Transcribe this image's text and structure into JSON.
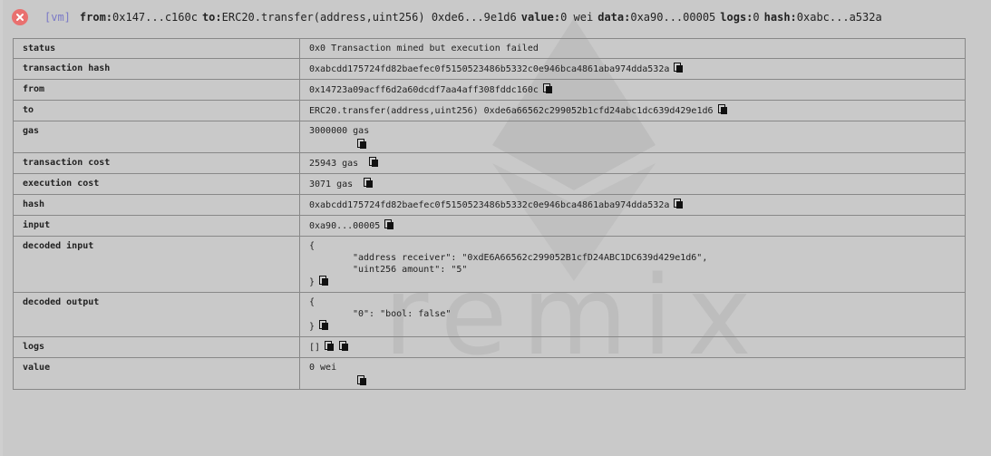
{
  "summary": {
    "env": "[vm]",
    "from_key": "from:",
    "from_value": "0x147...c160c",
    "to_key": "to:",
    "to_value": "ERC20.transfer(address,uint256) 0xde6...9e1d6",
    "value_key": "value:",
    "value_value": "0 wei",
    "data_key": "data:",
    "data_value": "0xa90...00005",
    "logs_key": "logs:",
    "logs_value": "0",
    "hash_key": "hash:",
    "hash_value": "0xabc...a532a"
  },
  "watermark": {
    "text": "remix"
  },
  "details": {
    "status": {
      "label": "status",
      "value": "0x0 Transaction mined but execution failed"
    },
    "transaction_hash": {
      "label": "transaction hash",
      "value": "0xabcdd175724fd82baefec0f5150523486b5332c0e946bca4861aba974dda532a"
    },
    "from": {
      "label": "from",
      "value": "0x14723a09acff6d2a60dcdf7aa4aff308fddc160c"
    },
    "to": {
      "label": "to",
      "value": "ERC20.transfer(address,uint256) 0xde6a66562c299052b1cfd24abc1dc639d429e1d6"
    },
    "gas": {
      "label": "gas",
      "value": "3000000 gas"
    },
    "transaction_cost": {
      "label": "transaction cost",
      "value": "25943 gas"
    },
    "execution_cost": {
      "label": "execution cost",
      "value": "3071 gas"
    },
    "hash": {
      "label": "hash",
      "value": "0xabcdd175724fd82baefec0f5150523486b5332c0e946bca4861aba974dda532a"
    },
    "input": {
      "label": "input",
      "value": "0xa90...00005"
    },
    "decoded_input": {
      "label": "decoded input",
      "open": "{",
      "line1": "\"address receiver\": \"0xdE6A66562c299052B1cfD24ABC1DC639d429e1d6\",",
      "line2": "\"uint256 amount\": \"5\"",
      "close": "}"
    },
    "decoded_output": {
      "label": "decoded output",
      "open": "{",
      "line1": "\"0\": \"bool: false\"",
      "close": "}"
    },
    "logs": {
      "label": "logs",
      "value": "[]"
    },
    "value": {
      "label": "value",
      "value": "0 wei"
    }
  }
}
